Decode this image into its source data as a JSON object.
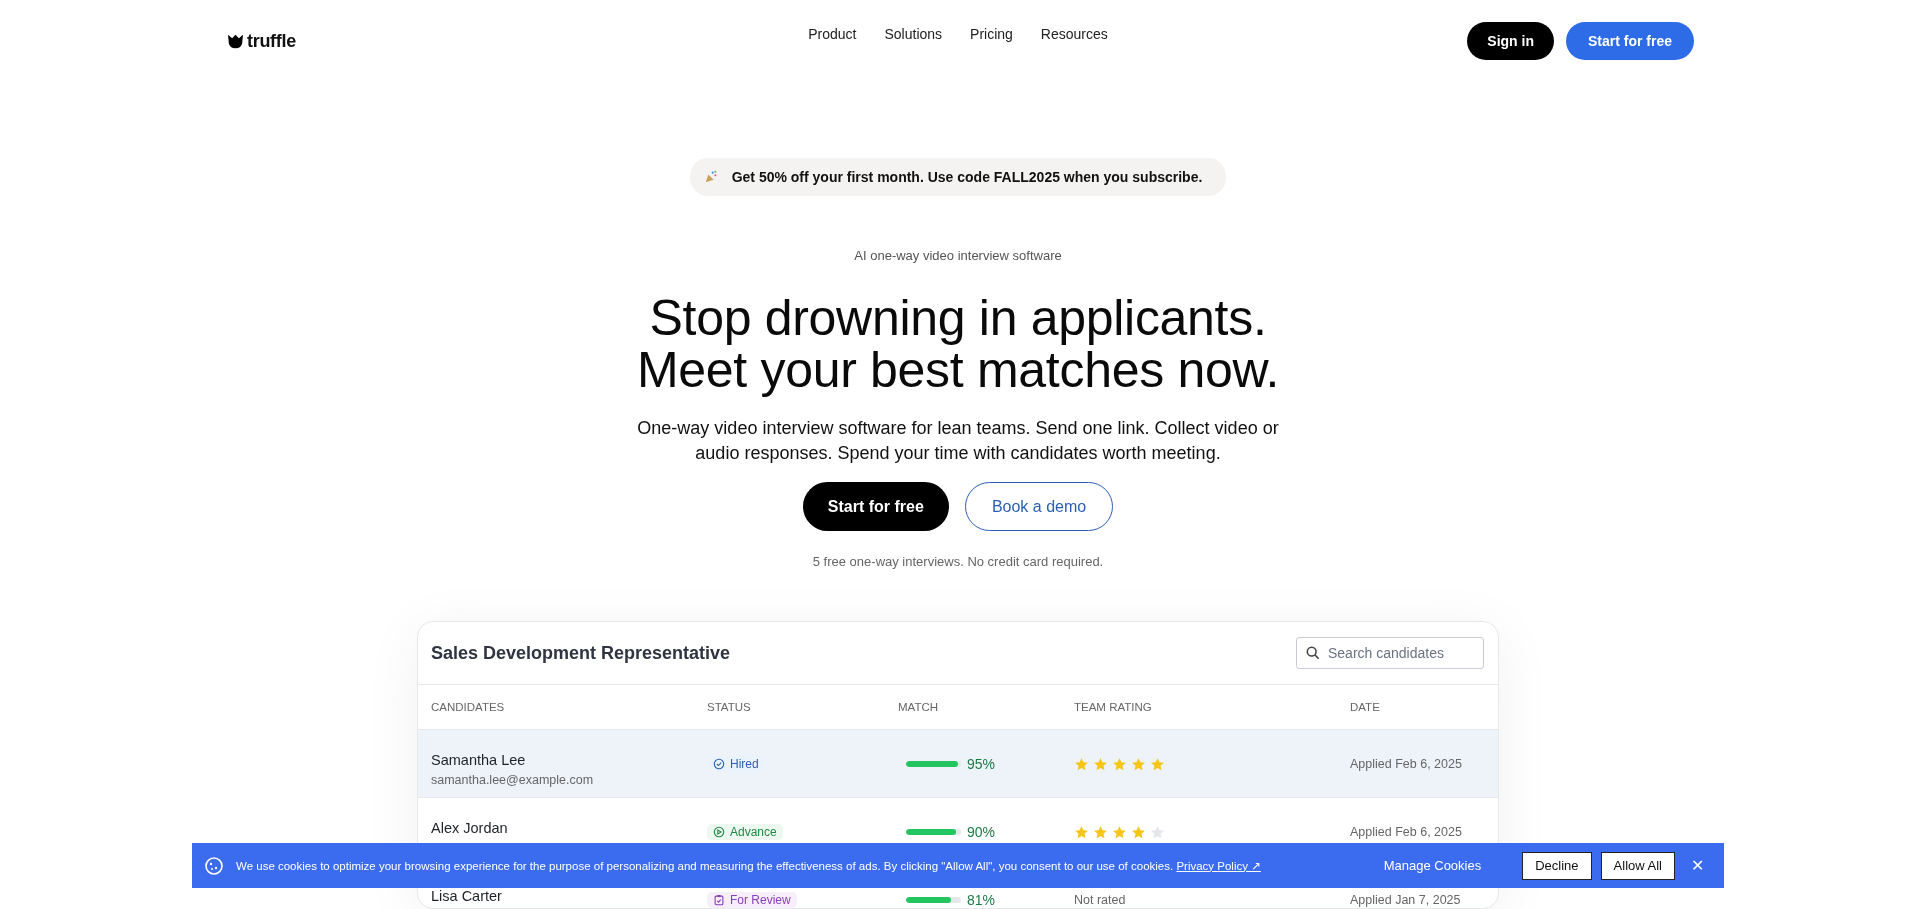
{
  "header": {
    "logo": "truffle",
    "nav": [
      "Product",
      "Solutions",
      "Pricing",
      "Resources"
    ],
    "sign_in": "Sign in",
    "start": "Start for free"
  },
  "promo": {
    "text": "Get 50% off your first month. Use code FALL2025 when you subscribe."
  },
  "hero": {
    "eyebrow": "AI one-way video interview software",
    "headline": [
      "Stop drowning in applicants.",
      "Meet your best matches now."
    ],
    "description": "One-way video interview software for lean teams. Send one link. Collect video or audio responses. Spend your time with candidates worth meeting.",
    "primary_button": "Start for free",
    "secondary_button": "Book a demo",
    "note": "5 free one-way interviews.  No credit card required."
  },
  "table": {
    "title": "Sales Development Representative",
    "search": {
      "placeholder": "Search candidates"
    },
    "columns": [
      "CANDIDATES",
      "STATUS",
      "MATCH",
      "TEAM RATING",
      "DATE"
    ],
    "rows": [
      {
        "name": "Samantha Lee",
        "email": "samantha.lee@example.com",
        "status": {
          "kind": "hired",
          "label": "Hired"
        },
        "match": {
          "level": 0.95,
          "reading": "95%"
        },
        "rating": {
          "kind": "stars",
          "stars": 5
        },
        "date": "Applied Feb 6, 2025",
        "selected": true
      },
      {
        "name": "Alex Jordan",
        "status": {
          "kind": "advance",
          "label": "Advance"
        },
        "match": {
          "level": 0.9,
          "reading": "90%"
        },
        "rating": {
          "kind": "stars",
          "stars": 4
        },
        "date": "Applied Feb 6, 2025",
        "selected": false
      },
      {
        "name": "Lisa Carter",
        "status": {
          "kind": "review",
          "label": "For Review"
        },
        "match": {
          "level": 0.81,
          "reading": "81%"
        },
        "rating": {
          "kind": "text",
          "text": "Not rated"
        },
        "date": "Applied Jan 7, 2025",
        "selected": false
      }
    ]
  },
  "cookie_banner": {
    "text": "We use cookies to optimize your browsing experience for the purpose of personalizing and measuring the effectiveness of ads. By clicking \"Allow All\", you consent to our use of cookies.",
    "link": "Privacy Policy ↗",
    "manage": "Manage Cookies",
    "decline": "Decline",
    "allow": "Allow All",
    "close": "✕"
  }
}
